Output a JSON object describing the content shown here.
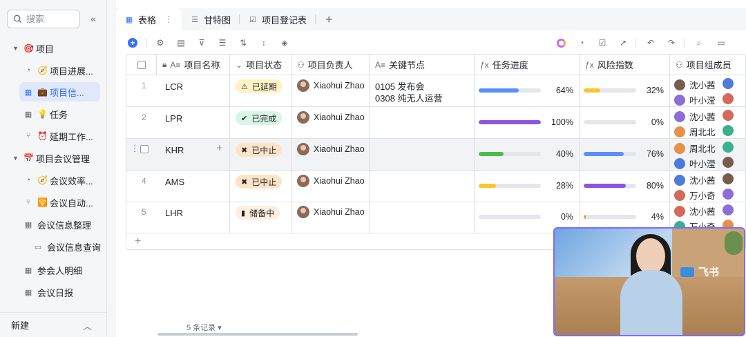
{
  "sidebar": {
    "search_placeholder": "搜索",
    "items": [
      {
        "label": "项目",
        "emoji": "🎯"
      },
      {
        "label": "项目进展...",
        "emoji": "🧭"
      },
      {
        "label": "项目信...",
        "emoji": "💼"
      },
      {
        "label": "任务",
        "emoji": "💡"
      },
      {
        "label": "延期工作...",
        "emoji": "⏰"
      },
      {
        "label": "项目会议管理",
        "emoji": "📅"
      },
      {
        "label": "会议效率...",
        "emoji": "🧭"
      },
      {
        "label": "会议自动...",
        "emoji": "🛜"
      },
      {
        "label": "会议信息整理",
        "emoji": ""
      },
      {
        "label": "会议信息查询",
        "emoji": ""
      },
      {
        "label": "参会人明细",
        "emoji": ""
      },
      {
        "label": "会议日报",
        "emoji": ""
      }
    ],
    "new_label": "新建"
  },
  "tabs": [
    {
      "label": "表格"
    },
    {
      "label": "甘特图"
    },
    {
      "label": "项目登记表"
    }
  ],
  "columns": [
    "项目名称",
    "项目状态",
    "项目负责人",
    "关键节点",
    "任务进度",
    "风险指数",
    "项目组成员"
  ],
  "rows": [
    {
      "num": "1",
      "name": "LCR",
      "status": "已延期",
      "status_icon": "⚠",
      "status_bg": "#fff3c4",
      "owner": "Xiaohui Zhao",
      "milestones": [
        "0105 发布会",
        "0308 纯无人运营"
      ],
      "progress": "64%",
      "progress_value": 64,
      "progress_color": "#5b8ff9",
      "risk": "32%",
      "risk_value": 32,
      "risk_color": "#f7c530",
      "members": [
        {
          "name": "沈小茜"
        },
        {
          "name": "叶小滢"
        }
      ]
    },
    {
      "num": "2",
      "name": "LPR",
      "status": "已完成",
      "status_icon": "✔",
      "status_bg": "#d9f5e6",
      "owner": "Xiaohui Zhao",
      "milestones": [],
      "progress": "100%",
      "progress_value": 100,
      "progress_color": "#8d54e0",
      "risk": "0%",
      "risk_value": 0,
      "risk_color": "#f7c530",
      "members": [
        {
          "name": "沈小茜"
        },
        {
          "name": "周北北"
        }
      ]
    },
    {
      "num": "3",
      "name": "KHR",
      "status": "已中止",
      "status_icon": "✖",
      "status_bg": "#fde4c8",
      "owner": "Xiaohui Zhao",
      "milestones": [],
      "progress": "40%",
      "progress_value": 40,
      "progress_color": "#4cbb4c",
      "risk": "76%",
      "risk_value": 76,
      "risk_color": "#5b8ff9",
      "members": [
        {
          "name": "周北北"
        },
        {
          "name": "叶小滢"
        }
      ]
    },
    {
      "num": "4",
      "name": "AMS",
      "status": "已中止",
      "status_icon": "✖",
      "status_bg": "#fde4c8",
      "owner": "Xiaohui Zhao",
      "milestones": [],
      "progress": "28%",
      "progress_value": 28,
      "progress_color": "#f7c530",
      "risk": "80%",
      "risk_value": 80,
      "risk_color": "#8d54e0",
      "members": [
        {
          "name": "沈小茜"
        },
        {
          "name": "万小奇"
        }
      ]
    },
    {
      "num": "5",
      "name": "LHR",
      "status": "储备中",
      "status_icon": "▮",
      "status_bg": "#fdeedd",
      "owner": "Xiaohui Zhao",
      "milestones": [],
      "progress": "0%",
      "progress_value": 0,
      "progress_color": "#5b8ff9",
      "risk": "4%",
      "risk_value": 4,
      "risk_color": "#f59a23",
      "members": [
        {
          "name": "沈小茜"
        },
        {
          "name": "万小奇"
        }
      ]
    }
  ],
  "footer": {
    "records": "5 条记录"
  },
  "video": {
    "logo_text": "飞书"
  }
}
